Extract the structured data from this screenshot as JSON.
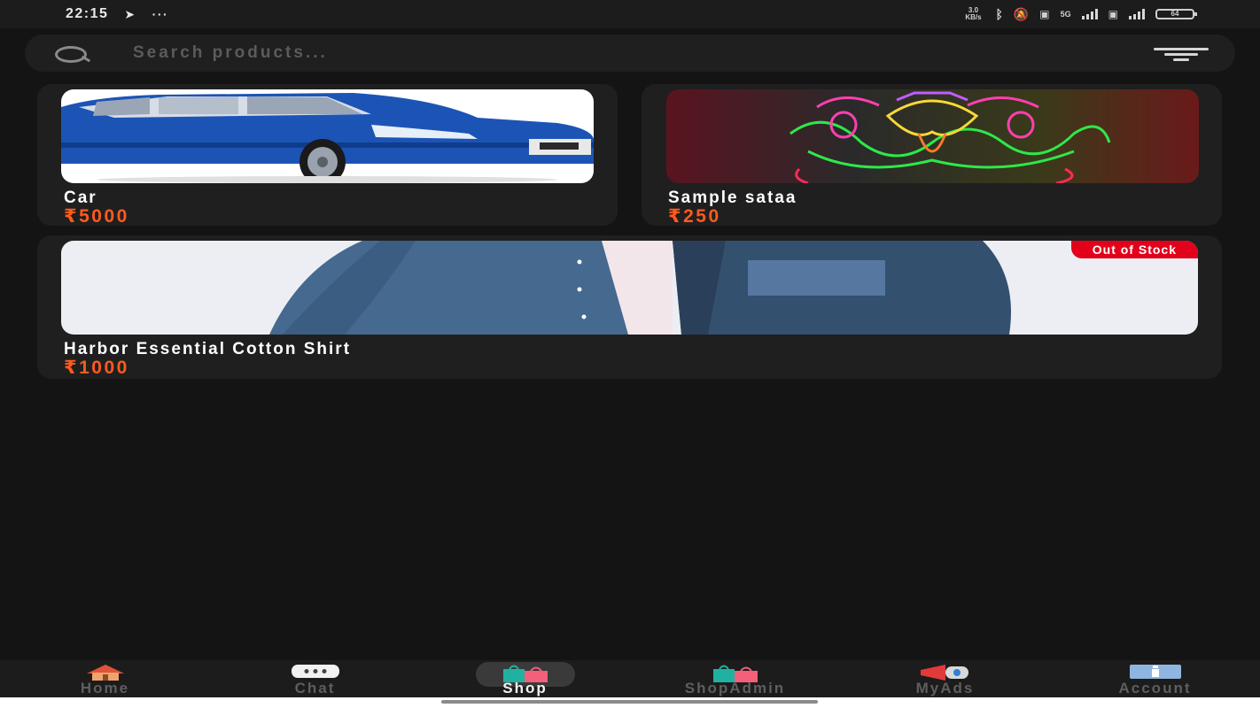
{
  "status_bar": {
    "time": "22:15",
    "extra": "···",
    "network_speed": "3.0 KB/s",
    "network_type": "5G",
    "battery": "64"
  },
  "search": {
    "placeholder": "Search products..."
  },
  "products": [
    {
      "name": "Car",
      "price": "₹5000",
      "out_of_stock": false
    },
    {
      "name": "Sample sataa",
      "price": "₹250",
      "out_of_stock": false
    },
    {
      "name": "Harbor Essential Cotton Shirt",
      "price": "₹1000",
      "out_of_stock": true,
      "badge": "Out of Stock"
    }
  ],
  "nav": {
    "items": [
      {
        "label": "Home",
        "icon": "home-icon",
        "active": false
      },
      {
        "label": "Chat",
        "icon": "chat-icon",
        "active": false
      },
      {
        "label": "Shop",
        "icon": "shopping-bags-icon",
        "active": true
      },
      {
        "label": "ShopAdmin",
        "icon": "shopping-bags-icon",
        "active": false
      },
      {
        "label": "MyAds",
        "icon": "megaphone-icon",
        "active": false
      },
      {
        "label": "Account",
        "icon": "id-card-icon",
        "active": false
      }
    ]
  },
  "colors": {
    "background": "#141414",
    "card": "#1f1f1f",
    "price": "#ff5a1f",
    "badge": "#e3001b"
  }
}
